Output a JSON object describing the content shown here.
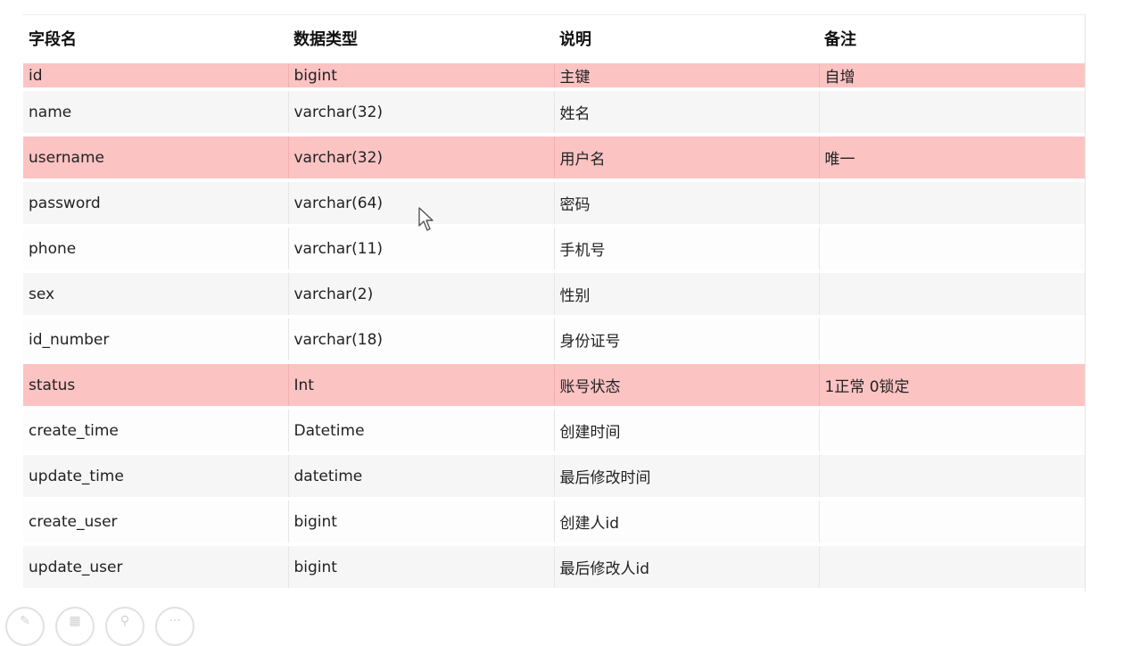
{
  "table": {
    "headers": [
      "字段名",
      "数据类型",
      "说明",
      "备注"
    ],
    "rows": [
      {
        "field": "id",
        "type": "bigint",
        "desc": "主键",
        "note": "自增",
        "highlight": true
      },
      {
        "field": "name",
        "type": "varchar(32)",
        "desc": "姓名",
        "note": "",
        "highlight": false
      },
      {
        "field": "username",
        "type": "varchar(32)",
        "desc": "用户名",
        "note": "唯一",
        "highlight": true
      },
      {
        "field": "password",
        "type": "varchar(64)",
        "desc": "密码",
        "note": "",
        "highlight": false
      },
      {
        "field": "phone",
        "type": "varchar(11)",
        "desc": "手机号",
        "note": "",
        "highlight": false
      },
      {
        "field": "sex",
        "type": "varchar(2)",
        "desc": "性别",
        "note": "",
        "highlight": false
      },
      {
        "field": "id_number",
        "type": "varchar(18)",
        "desc": "身份证号",
        "note": "",
        "highlight": false
      },
      {
        "field": "status",
        "type": "Int",
        "desc": "账号状态",
        "note": "1正常 0锁定",
        "highlight": true
      },
      {
        "field": "create_time",
        "type": "Datetime",
        "desc": "创建时间",
        "note": "",
        "highlight": false
      },
      {
        "field": "update_time",
        "type": "datetime",
        "desc": "最后修改时间",
        "note": "",
        "highlight": false
      },
      {
        "field": "create_user",
        "type": "bigint",
        "desc": "创建人id",
        "note": "",
        "highlight": false
      },
      {
        "field": "update_user",
        "type": "bigint",
        "desc": "最后修改人id",
        "note": "",
        "highlight": false
      }
    ]
  },
  "colors": {
    "highlight_row": "#fcc3c3",
    "stripe_row": "#f6f6f6"
  },
  "toolbar": {
    "icons": [
      "pen-icon",
      "layout-icon",
      "zoom-icon",
      "more-icon"
    ]
  }
}
